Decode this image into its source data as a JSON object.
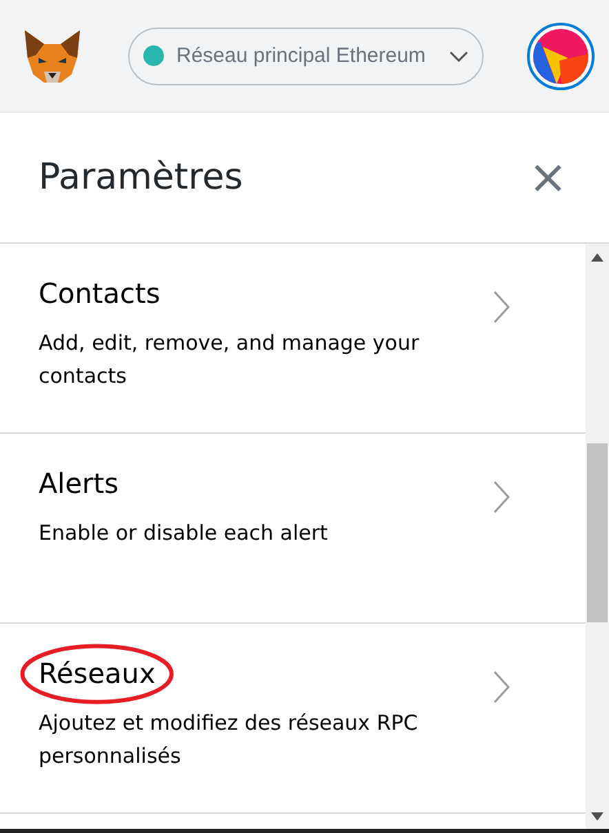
{
  "header": {
    "network": {
      "label": "Réseau principal Ethereum"
    }
  },
  "settings": {
    "title": "Paramètres",
    "close": "×",
    "items": [
      {
        "title": "Contacts",
        "description": "Add, edit, remove, and manage your contacts",
        "highlighted": false
      },
      {
        "title": "Alerts",
        "description": "Enable or disable each alert",
        "highlighted": false
      },
      {
        "title": "Réseaux",
        "description": "Ajoutez et modifiez des réseaux RPC personnalisés",
        "highlighted": true
      }
    ]
  }
}
